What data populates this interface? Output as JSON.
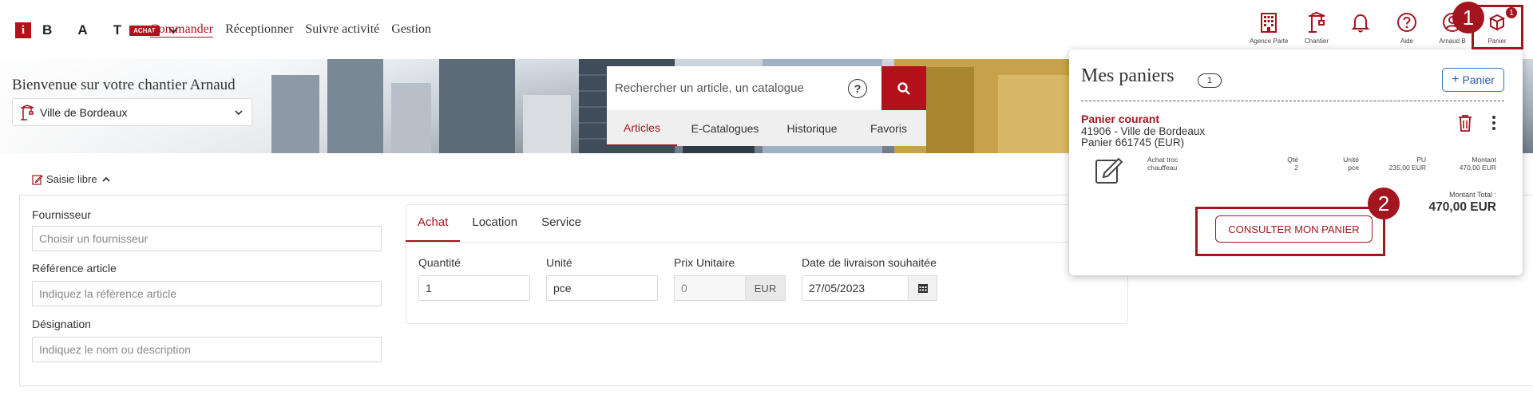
{
  "brand": {
    "letters": "B A T",
    "badge": "ACHAT"
  },
  "nav": [
    "Commander",
    "Réceptionner",
    "Suivre activité",
    "Gestion"
  ],
  "top_icons": [
    {
      "label": "Agence Partenaire",
      "icon": "building-icon"
    },
    {
      "label": "Chantier",
      "icon": "crane-icon"
    },
    {
      "label": "",
      "icon": "bell-icon"
    },
    {
      "label": "Aide",
      "icon": "help-icon"
    },
    {
      "label": "Arnaud B",
      "icon": "user-icon"
    },
    {
      "label": "Panier",
      "icon": "cart-icon",
      "badge": "1"
    }
  ],
  "hero": {
    "title": "Bienvenue sur votre chantier Arnaud",
    "site": "Ville de Bordeaux"
  },
  "search": {
    "placeholder": "Rechercher un article, un catalogue",
    "help": "?",
    "tabs": [
      "Articles",
      "E-Catalogues",
      "Historique",
      "Favoris"
    ]
  },
  "saisie": {
    "toggle": "Saisie libre",
    "fournisseur_label": "Fournisseur",
    "fournisseur_placeholder": "Choisir un fournisseur",
    "reference_label": "Référence article",
    "reference_placeholder": "Indiquez la référence article",
    "designation_label": "Désignation",
    "designation_placeholder": "Indiquez le nom ou description",
    "tabs": [
      "Achat",
      "Location",
      "Service"
    ],
    "quantite_label": "Quantité",
    "quantite_value": "1",
    "unite_label": "Unité",
    "unite_value": "pce",
    "prix_label": "Prix Unitaire",
    "prix_placeholder": "0",
    "prix_currency": "EUR",
    "date_label": "Date de livraison souhaitée",
    "date_value": "27/05/2023"
  },
  "cart": {
    "title": "Mes paniers",
    "count": "1",
    "add_label": "Panier",
    "current_label": "Panier courant",
    "chantier_line": "41906 - Ville de Bordeaux",
    "panier_line": "Panier 661745 (EUR)",
    "item": {
      "name_line1": "Achat troc",
      "name_line2": "chauffeau",
      "qte_label": "Qté",
      "qte_value": "2",
      "unite_label": "Unité",
      "unite_value": "pce",
      "pu_label": "PU",
      "pu_value": "235,00 EUR",
      "montant_label": "Montant",
      "montant_value": "470,00 EUR"
    },
    "total_label": "Montant Total :",
    "total_value": "470,00 EUR",
    "consult_label": "CONSULTER MON PANIER"
  },
  "annotations": {
    "one": "1",
    "two": "2"
  },
  "colors": {
    "brand_red": "#a31620",
    "link_blue": "#2a5ca8"
  }
}
